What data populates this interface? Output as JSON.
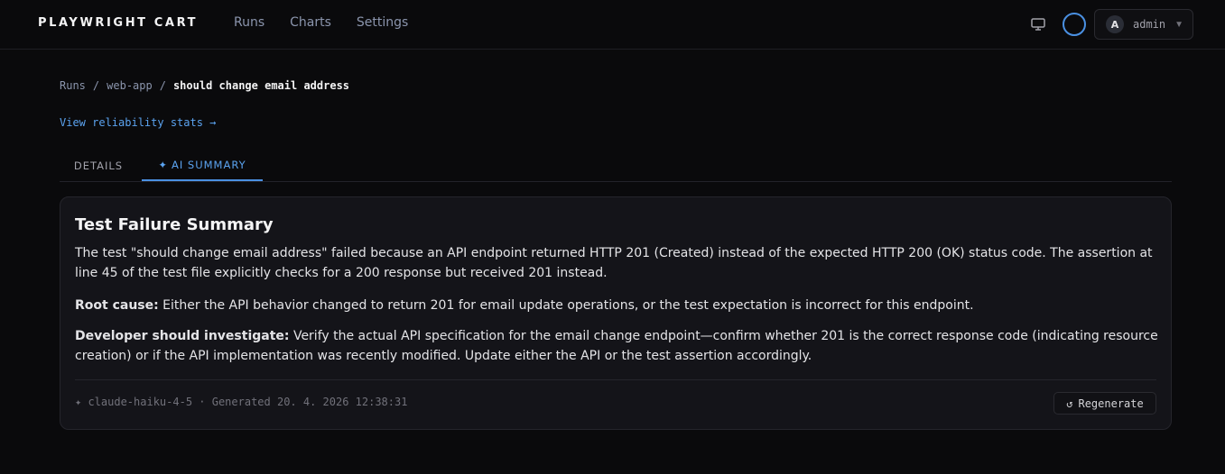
{
  "header": {
    "brand": "PLAYWRIGHT CART",
    "nav": [
      "Runs",
      "Charts",
      "Settings"
    ],
    "user": {
      "initial": "A",
      "name": "admin"
    }
  },
  "breadcrumb": {
    "root": "Runs",
    "project": "web-app",
    "current": "should change email address",
    "sep": "/"
  },
  "stats_link": "View reliability stats →",
  "tabs": {
    "details": "DETAILS",
    "ai_icon": "✦",
    "ai": "AI SUMMARY"
  },
  "summary": {
    "title": "Test Failure Summary",
    "p1": "The test \"should change email address\" failed because an API endpoint returned HTTP 201 (Created) instead of the expected HTTP 200 (OK) status code. The assertion at line 45 of the test file explicitly checks for a 200 response but received 201 instead.",
    "root_cause_label": "Root cause:",
    "root_cause": " Either the API behavior changed to return 201 for email update operations, or the test expectation is incorrect for this endpoint.",
    "investigate_label": "Developer should investigate:",
    "investigate": " Verify the actual API specification for the email change endpoint—confirm whether 201 is the correct response code (indicating resource creation) or if the API implementation was recently modified. Update either the API or the test assertion accordingly.",
    "meta": "✦ claude-haiku-4-5 · Generated 20. 4. 2026 12:38:31",
    "regen_icon": "↺",
    "regen_label": "Regenerate"
  },
  "colors": {
    "accent": "#4a90e2",
    "link": "#5ba3f0",
    "background": "#0a0a0c",
    "card": "#141419"
  }
}
